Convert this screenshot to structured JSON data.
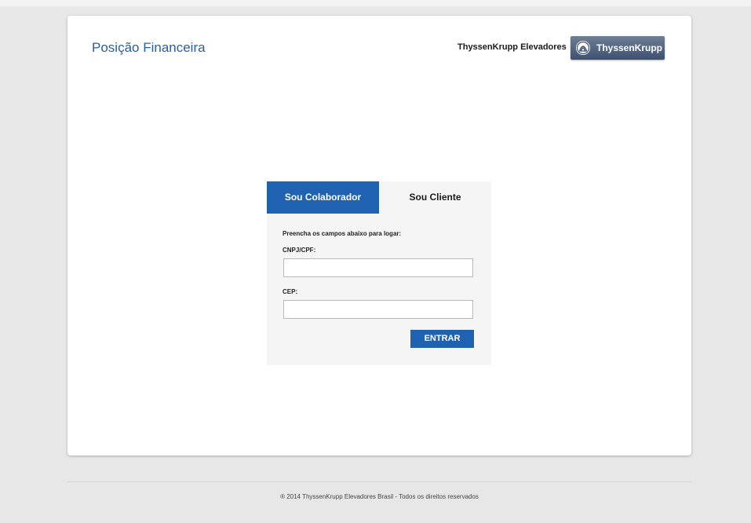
{
  "header": {
    "page_title": "Posição Financeira",
    "company_name": "ThyssenKrupp Elevadores",
    "logo_text": "ThyssenKrupp",
    "logo_icon": "thyssenkrupp-arches-icon"
  },
  "login": {
    "tabs": [
      {
        "label": "Sou Colaborador",
        "active": true
      },
      {
        "label": "Sou Cliente",
        "active": false
      }
    ],
    "instruction": "Preencha os campos abaixo para logar:",
    "cnpj_label": "CNPJ/CPF:",
    "cnpj_value": "",
    "cep_label": "CEP:",
    "cep_value": "",
    "submit_label": "ENTRAR"
  },
  "footer": {
    "copyright": "® 2014 ThyssenKrupp Elevadores Brasil - Todos os direitos reservados"
  },
  "colors": {
    "accent": "#1f62b1",
    "title": "#2a5f9c",
    "background": "#e7e7e7"
  }
}
